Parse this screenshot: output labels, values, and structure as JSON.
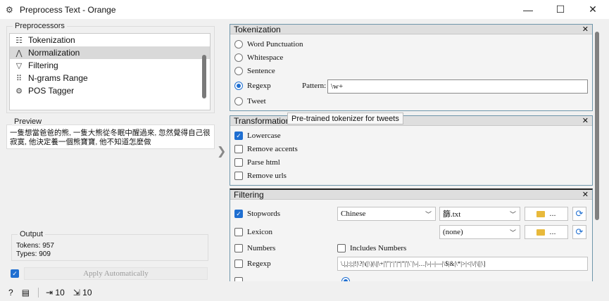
{
  "window": {
    "title": "Preprocess Text - Orange",
    "minimize": "—",
    "maximize": "☐",
    "close": "✕"
  },
  "preprocessors": {
    "label": "Preprocessors",
    "items": [
      {
        "label": "Tokenization",
        "icon": "tokenization-icon",
        "glyph": "☷"
      },
      {
        "label": "Normalization",
        "icon": "normalization-icon",
        "glyph": "⋀"
      },
      {
        "label": "Filtering",
        "icon": "filter-icon",
        "glyph": "▽"
      },
      {
        "label": "N-grams Range",
        "icon": "ngrams-icon",
        "glyph": "⠿"
      },
      {
        "label": "POS Tagger",
        "icon": "pos-tagger-icon",
        "glyph": "⚙"
      }
    ]
  },
  "preview": {
    "label": "Preview",
    "text": "一隻想當爸爸的熊, 一隻大熊從冬眠中醒過來, 忽然覺得自己很寂寞, 他決定養一個熊寶寶, 他不知道怎麼做"
  },
  "output": {
    "label": "Output",
    "tokens": "Tokens: 957",
    "types": "Types: 909"
  },
  "apply": {
    "label": "Apply Automatically",
    "checked": true
  },
  "statusbar": {
    "input_count": "10",
    "output_count": "10"
  },
  "tokenization": {
    "title": "Tokenization",
    "options": [
      "Word  Punctuation",
      "Whitespace",
      "Sentence",
      "Regexp",
      "Tweet"
    ],
    "selected": "Regexp",
    "pattern_label": "Pattern:",
    "pattern_value": "\\w+"
  },
  "tooltip": "Pre-trained tokenizer for tweets",
  "transformation": {
    "title": "Transformation",
    "options": [
      {
        "label": "Lowercase",
        "checked": true
      },
      {
        "label": "Remove accents",
        "checked": false
      },
      {
        "label": "Parse html",
        "checked": false
      },
      {
        "label": "Remove urls",
        "checked": false
      }
    ]
  },
  "filtering": {
    "title": "Filtering",
    "stopwords": {
      "label": "Stopwords",
      "checked": true,
      "language": "Chinese",
      "file": "篩.txt",
      "button": "..."
    },
    "lexicon": {
      "label": "Lexicon",
      "checked": false,
      "file": "(none)",
      "button": "..."
    },
    "numbers": {
      "label": "Numbers",
      "checked": false
    },
    "includes_numbers": {
      "label": "Includes Numbers",
      "checked": false
    },
    "regexp": {
      "label": "Regexp",
      "checked": false,
      "value": "\\.|,|:|;|!|\\?|\\(|\\)|\\||\\+|'|\"|‘|’|“|”|'|\\`|\\-|…|\\-|–|—|\\$|&|\\*|>|<|\\/|\\[|\\]"
    }
  },
  "colors": {
    "accent": "#1f6fd1",
    "box_border": "#6f96aa",
    "folder": "#e8b93b"
  }
}
